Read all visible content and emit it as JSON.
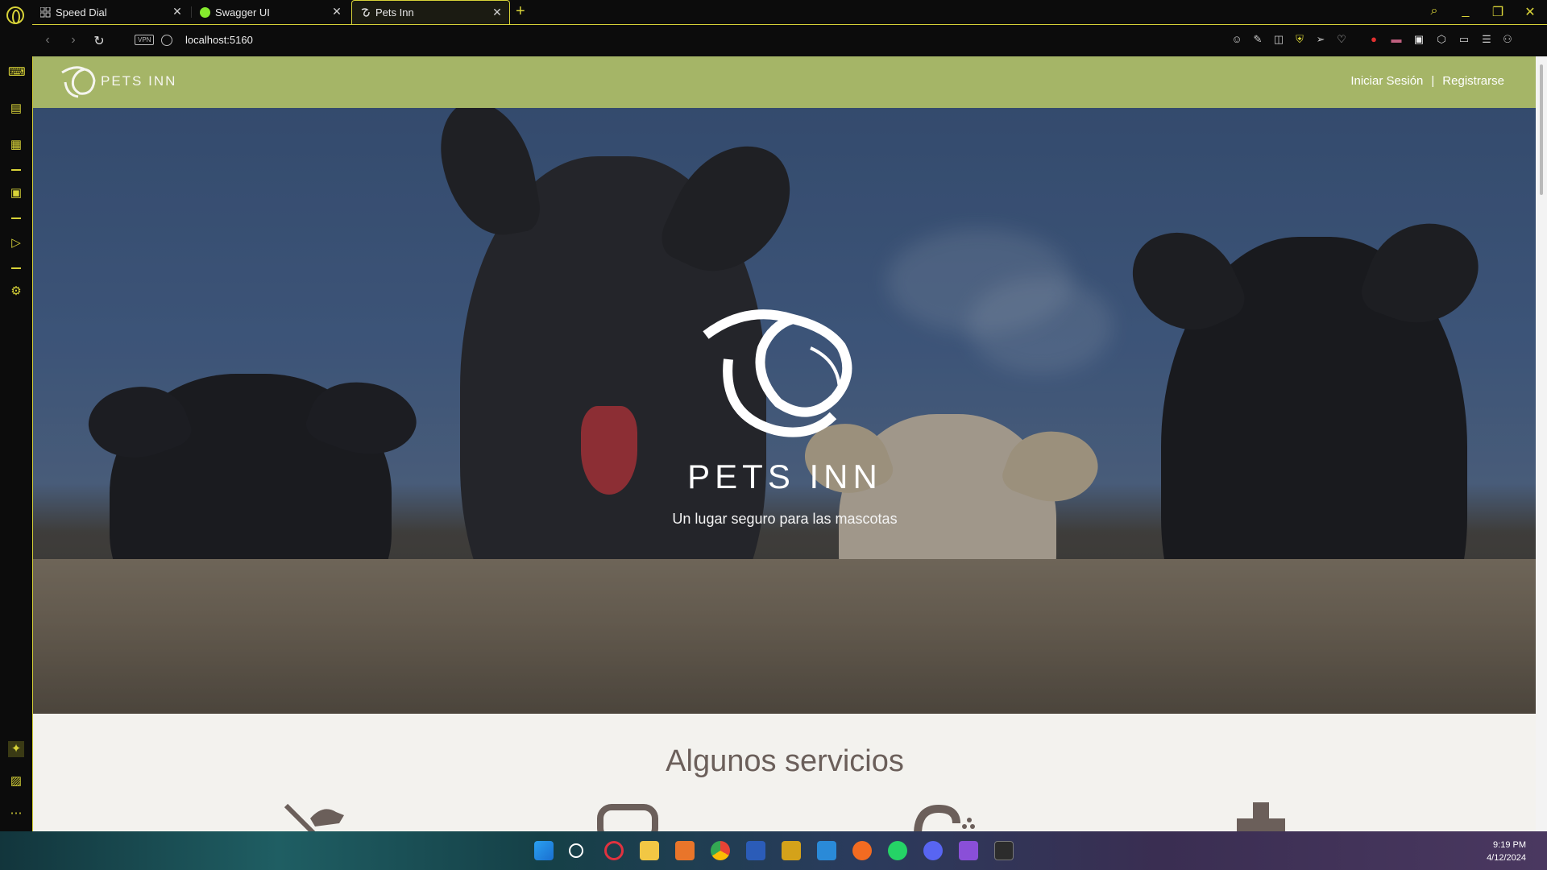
{
  "browser": {
    "tabs": [
      {
        "title": "Speed Dial",
        "active": false
      },
      {
        "title": "Swagger UI",
        "active": false
      },
      {
        "title": "Pets Inn",
        "active": true
      }
    ],
    "url": "localhost:5160",
    "vpn_label": "VPN"
  },
  "site": {
    "brand": "PETS INN",
    "nav": {
      "login": "Iniciar Sesión",
      "divider": "|",
      "register": "Registrarse"
    },
    "hero": {
      "title": "PETS INN",
      "subtitle": "Un lugar seguro para las mascotas"
    },
    "services": {
      "title": "Algunos servicios"
    }
  },
  "taskbar": {
    "time": "9:19 PM",
    "date": "4/12/2024"
  },
  "colors": {
    "header": "#a5b567",
    "accent": "#d8d338",
    "services_bg": "#f3f2ee",
    "services_icon": "#6b5f5a"
  }
}
